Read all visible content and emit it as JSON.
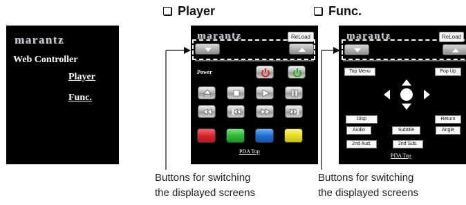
{
  "headers": {
    "player": "Player",
    "func": "Func."
  },
  "home_screen": {
    "brand": "marantz",
    "title": "Web Controller",
    "links": [
      "Player",
      "Func."
    ]
  },
  "player_screen": {
    "brand": "marantz",
    "reload_label": "ReLoad",
    "power_label": "Power",
    "power_buttons": [
      {
        "name": "power-off",
        "color": "#e02020"
      },
      {
        "name": "power-on",
        "color": "#20b020"
      }
    ],
    "transport_rows": [
      [
        "eject-icon",
        "stop-icon",
        "play-icon",
        "pause-icon"
      ],
      [
        "fast-rewind-icon",
        "skip-back-icon",
        "fast-forward-icon",
        "skip-forward-icon"
      ]
    ],
    "color_buttons": [
      "#d8262f",
      "#2fbb35",
      "#1f6fd6",
      "#e8de22"
    ],
    "bottom_link": "PDA Top"
  },
  "func_screen": {
    "brand": "marantz",
    "reload_label": "ReLoad",
    "buttons": {
      "top_menu": "Top Menu",
      "pop_up": "Pop Up",
      "disp": "Disp",
      "return": "Return",
      "audio": "Audio",
      "subtitle": "Subtitle",
      "angle": "Angle",
      "second_audio": "2nd Aud.",
      "second_sub": "2nd Sub."
    },
    "bottom_link": "PDA Top"
  },
  "captions": {
    "player": [
      "Buttons for switching",
      "the displayed screens"
    ],
    "func": [
      "Buttons for switching",
      "the displayed screens"
    ]
  }
}
